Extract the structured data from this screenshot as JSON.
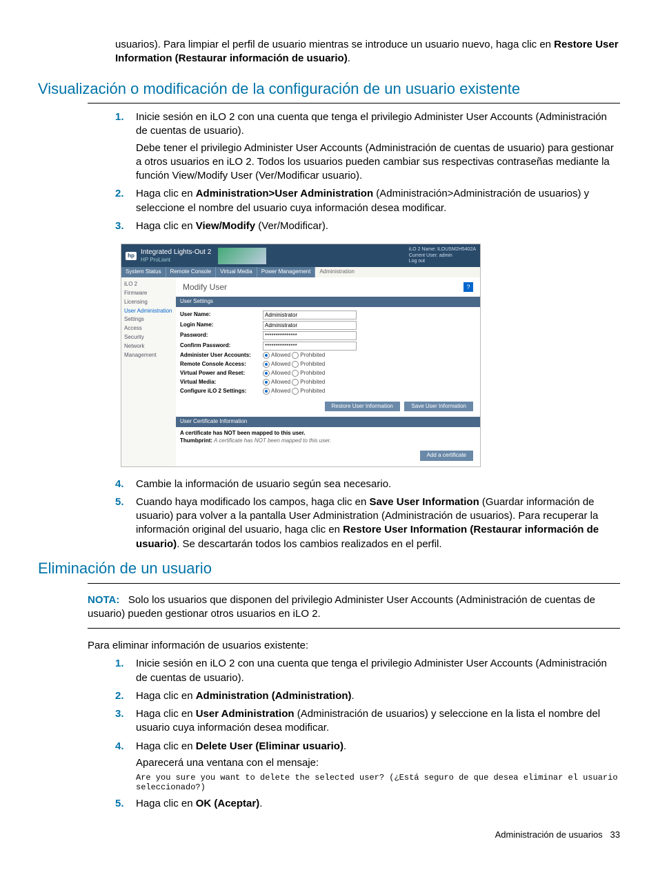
{
  "intro": {
    "text_before_bold": "usuarios). Para limpiar el perfil de usuario mientras se introduce un usuario nuevo, haga clic en ",
    "bold": "Restore User Information (Restaurar información de usuario)",
    "text_after_bold": "."
  },
  "section1": {
    "heading": "Visualización o modificación de la configuración de un usuario existente",
    "steps": {
      "s1": {
        "num": "1.",
        "p1": "Inicie sesión en iLO 2 con una cuenta que tenga el privilegio Administer User Accounts (Administración de cuentas de usuario).",
        "p2": "Debe tener el privilegio Administer User Accounts (Administración de cuentas de usuario) para gestionar a otros usuarios en iLO 2. Todos los usuarios pueden cambiar sus respectivas contraseñas mediante la función View/Modify User (Ver/Modificar usuario)."
      },
      "s2": {
        "num": "2.",
        "before": "Haga clic en ",
        "bold": "Administration>User Administration",
        "after": " (Administración>Administración de usuarios) y seleccione el nombre del usuario cuya información desea modificar."
      },
      "s3": {
        "num": "3.",
        "before": "Haga clic en ",
        "bold": "View/Modify",
        "after": " (Ver/Modificar)."
      },
      "s4": {
        "num": "4.",
        "text": "Cambie la información de usuario según sea necesario."
      },
      "s5": {
        "num": "5.",
        "t1": "Cuando haya modificado los campos, haga clic en ",
        "b1": "Save User Information",
        "t2": " (Guardar información de usuario) para volver a la pantalla User Administration (Administración de usuarios). Para recuperar la información original del usuario, haga clic en ",
        "b2": "Restore User Information (Restaurar información de usuario)",
        "t3": ". Se descartarán todos los cambios realizados en el perfil."
      }
    }
  },
  "screenshot": {
    "header": {
      "title": "Integrated Lights-Out 2",
      "sub": "HP ProLiant",
      "info1": "iLO 2 Name: ILOUSM2H5402A",
      "info2": "Current User: admin",
      "info3": "Log out"
    },
    "tabs": [
      "System Status",
      "Remote Console",
      "Virtual Media",
      "Power Management"
    ],
    "active_tab": "Administration",
    "sidebar": [
      "iLO 2",
      "Firmware",
      "Licensing",
      "User Administration",
      "Settings",
      "Access",
      "Security",
      "Network",
      "Management"
    ],
    "page_title": "Modify User",
    "section_bar1": "User Settings",
    "fields": {
      "user_name_lbl": "User Name:",
      "user_name_val": "Administrator",
      "login_name_lbl": "Login Name:",
      "login_name_val": "Administrator",
      "password_lbl": "Password:",
      "password_val": "***************",
      "confirm_lbl": "Confirm Password:",
      "confirm_val": "***************",
      "admin_lbl": "Administer User Accounts:",
      "remote_lbl": "Remote Console Access:",
      "power_lbl": "Virtual Power and Reset:",
      "vmedia_lbl": "Virtual Media:",
      "config_lbl": "Configure iLO 2 Settings:",
      "allowed": "Allowed",
      "prohibited": "Prohibited"
    },
    "btn_restore": "Restore User Information",
    "btn_save": "Save User Information",
    "section_bar2": "User Certificate Information",
    "cert_msg1": "A certificate has NOT been mapped to this user.",
    "cert_msg2_lbl": "Thumbprint:",
    "cert_msg2_txt": " A certificate has NOT been mapped to this user.",
    "btn_add_cert": "Add a certificate"
  },
  "section2": {
    "heading": "Eliminación de un usuario",
    "note_label": "NOTA:",
    "note_text": "Solo los usuarios que disponen del privilegio Administer User Accounts (Administración de cuentas de usuario) pueden gestionar otros usuarios en iLO 2.",
    "para": "Para eliminar información de usuarios existente:",
    "steps": {
      "s1": {
        "num": "1.",
        "text": "Inicie sesión en iLO 2 con una cuenta que tenga el privilegio Administer User Accounts (Administración de cuentas de usuario)."
      },
      "s2": {
        "num": "2.",
        "before": "Haga clic en ",
        "bold": "Administration (Administration)",
        "after": "."
      },
      "s3": {
        "num": "3.",
        "before": "Haga clic en ",
        "bold": "User Administration",
        "after": " (Administración de usuarios) y seleccione en la lista el nombre del usuario cuya información desea modificar."
      },
      "s4": {
        "num": "4.",
        "before": "Haga clic en ",
        "bold": "Delete User (Eliminar usuario)",
        "after": ".",
        "p2": "Aparecerá una ventana con el mensaje:",
        "code": "Are you sure you want to delete the selected user? (¿Está seguro de que desea eliminar el usuario seleccionado?)"
      },
      "s5": {
        "num": "5.",
        "before": "Haga clic en ",
        "bold": "OK (Aceptar)",
        "after": "."
      }
    }
  },
  "footer": {
    "text": "Administración de usuarios",
    "page": "33"
  }
}
